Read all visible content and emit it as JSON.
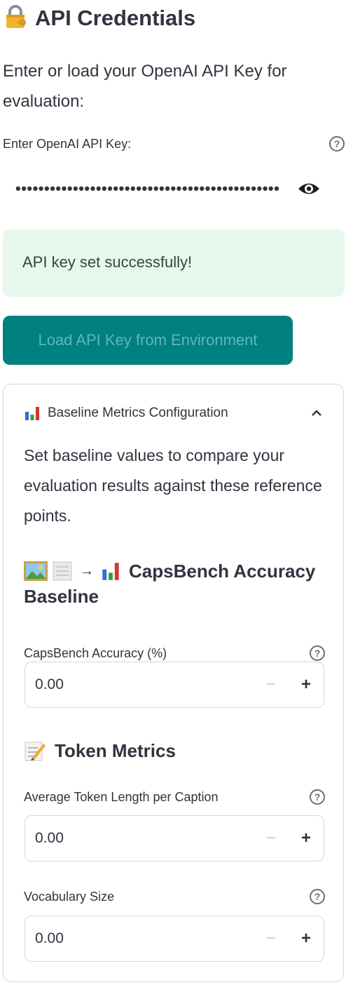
{
  "header": {
    "title": "API Credentials",
    "icon": "locked-with-key-icon"
  },
  "description": "Enter or load your OpenAI API Key for evaluation:",
  "api_key_field": {
    "label": "Enter OpenAI API Key:",
    "masked_value": "••••••••••••••••••••••••••••••••••••••••••••••",
    "help_symbol": "?"
  },
  "success_message": "API key set successfully!",
  "load_button_label": "Load API Key from Environment",
  "expander": {
    "title": "Baseline Metrics Configuration",
    "description": "Set baseline values to compare your evaluation results against these reference points.",
    "caps_section": {
      "heading_arrow": "→",
      "heading_text": "CapsBench Accuracy",
      "heading_text_2": "Baseline",
      "field": {
        "label": "CapsBench Accuracy (%)",
        "value": "0.00"
      }
    },
    "token_section": {
      "heading_text": "Token Metrics",
      "fields": [
        {
          "label": "Average Token Length per Caption",
          "value": "0.00"
        },
        {
          "label": "Vocabulary Size",
          "value": "0.00"
        }
      ]
    }
  },
  "symbols": {
    "help": "?",
    "minus": "−",
    "plus": "+"
  },
  "colors": {
    "button_bg": "#008080",
    "success_bg": "#e7f7ec",
    "text": "#31333f"
  }
}
